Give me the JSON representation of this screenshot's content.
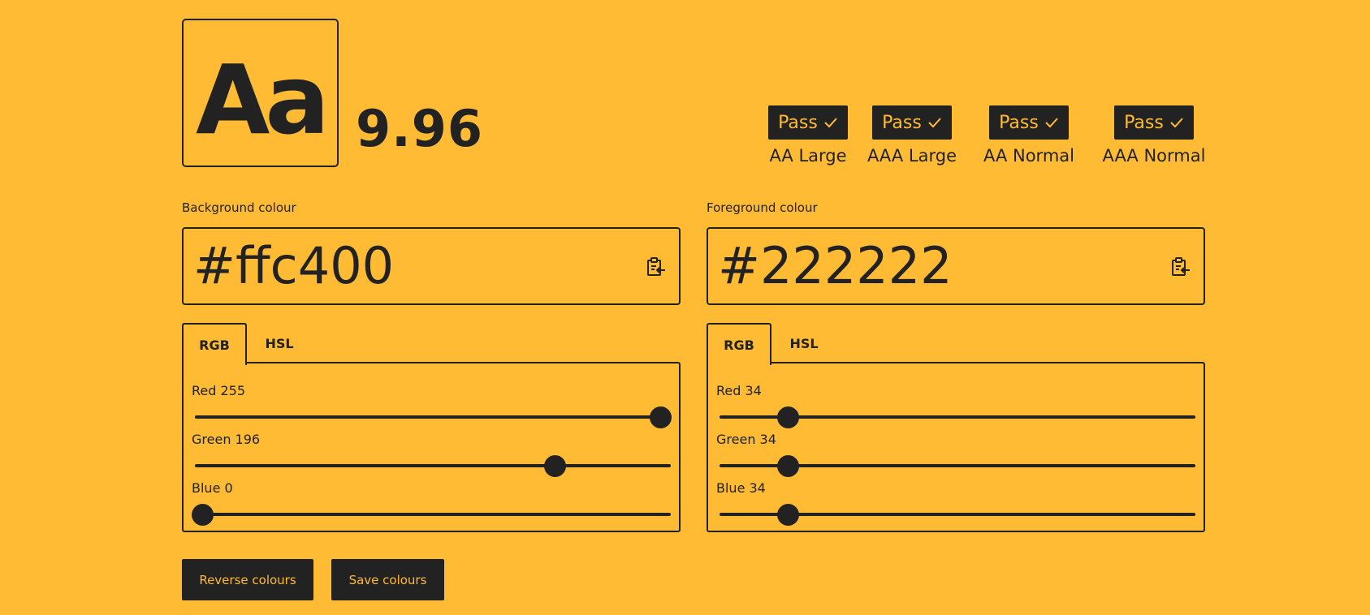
{
  "preview": {
    "sample_text": "Aa",
    "contrast_ratio": "9.96"
  },
  "results": [
    {
      "status": "Pass",
      "label": "AA Large"
    },
    {
      "status": "Pass",
      "label": "AAA Large"
    },
    {
      "status": "Pass",
      "label": "AA Normal"
    },
    {
      "status": "Pass",
      "label": "AAA Normal"
    }
  ],
  "background": {
    "label": "Background colour",
    "hex": "#ffc400",
    "tabs": [
      "RGB",
      "HSL"
    ],
    "active_tab": "RGB",
    "sliders": [
      {
        "label": "Red 255",
        "value": 255,
        "max": 255
      },
      {
        "label": "Green 196",
        "value": 196,
        "max": 255
      },
      {
        "label": "Blue 0",
        "value": 0,
        "max": 255
      }
    ]
  },
  "foreground": {
    "label": "Foreground colour",
    "hex": "#222222",
    "tabs": [
      "RGB",
      "HSL"
    ],
    "active_tab": "RGB",
    "sliders": [
      {
        "label": "Red 34",
        "value": 34,
        "max": 255
      },
      {
        "label": "Green 34",
        "value": 34,
        "max": 255
      },
      {
        "label": "Blue 34",
        "value": 34,
        "max": 255
      }
    ]
  },
  "actions": {
    "reverse_label": "Reverse colours",
    "save_label": "Save colours"
  },
  "icons": {
    "paste": "clipboard-paste-icon",
    "check": "check-icon"
  },
  "colors": {
    "page_background": "#ffbb33",
    "foreground": "#222222"
  }
}
